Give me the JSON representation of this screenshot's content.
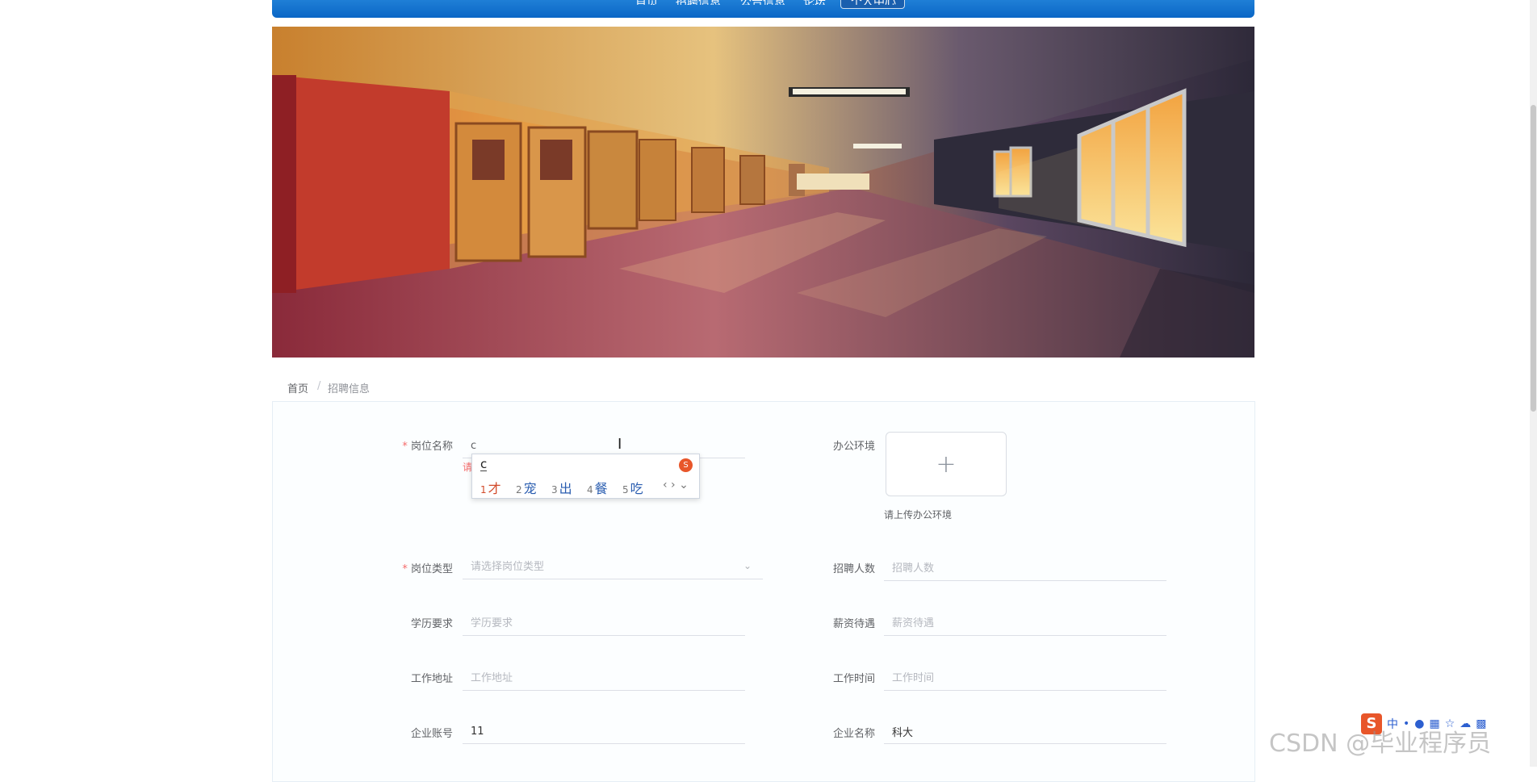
{
  "nav": {
    "items": [
      "首页",
      "招聘信息",
      "公告信息",
      "论坛",
      "个人中心"
    ]
  },
  "breadcrumb": {
    "home": "首页",
    "separator": "/",
    "current": "招聘信息"
  },
  "form": {
    "position_name": {
      "label": "岗位名称",
      "value": "c",
      "error_stub": "请"
    },
    "office_env": {
      "label": "办公环境",
      "upload_plus": "+",
      "hint": "请上传办公环境"
    },
    "position_type": {
      "label": "岗位类型",
      "placeholder": "请选择岗位类型"
    },
    "headcount": {
      "label": "招聘人数",
      "placeholder": "招聘人数"
    },
    "education": {
      "label": "学历要求",
      "placeholder": "学历要求"
    },
    "salary": {
      "label": "薪资待遇",
      "placeholder": "薪资待遇"
    },
    "work_address": {
      "label": "工作地址",
      "placeholder": "工作地址"
    },
    "work_time": {
      "label": "工作时间",
      "placeholder": "工作时间"
    },
    "company_account": {
      "label": "企业账号",
      "value": "11"
    },
    "company_name": {
      "label": "企业名称",
      "value": "科大"
    }
  },
  "ime": {
    "composition": "c",
    "candidates": [
      {
        "num": "1",
        "text": "才"
      },
      {
        "num": "2",
        "text": "宠"
      },
      {
        "num": "3",
        "text": "出"
      },
      {
        "num": "4",
        "text": "餐"
      },
      {
        "num": "5",
        "text": "吃"
      }
    ],
    "nav": "‹ › ⌄"
  },
  "tray": {
    "logo": "S",
    "mode": "中"
  },
  "watermark": "CSDN @毕业程序员",
  "colors": {
    "accent": "#0a66c6",
    "required": "#f56c6c",
    "candidate": "#2a5db0"
  }
}
